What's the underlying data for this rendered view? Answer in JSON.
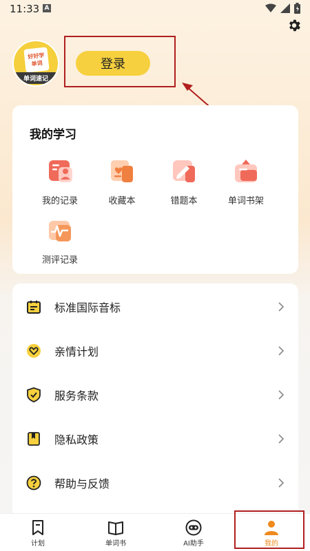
{
  "status_bar": {
    "time": "11:33",
    "notif_letter": "A"
  },
  "header": {
    "avatar_line1": "好好学",
    "avatar_line2": "单词",
    "avatar_ribbon": "单词速记",
    "login_label": "登录"
  },
  "study": {
    "title": "我的学习",
    "items": [
      {
        "label": "我的记录",
        "icon": "record-icon"
      },
      {
        "label": "收藏本",
        "icon": "favorites-icon"
      },
      {
        "label": "错题本",
        "icon": "wrong-answers-icon"
      },
      {
        "label": "单词书架",
        "icon": "bookshelf-icon"
      },
      {
        "label": "测评记录",
        "icon": "assessment-icon"
      }
    ]
  },
  "menu": {
    "items": [
      {
        "label": "标准国际音标",
        "icon": "calendar-icon"
      },
      {
        "label": "亲情计划",
        "icon": "heart-icon"
      },
      {
        "label": "服务条款",
        "icon": "shield-check-icon"
      },
      {
        "label": "隐私政策",
        "icon": "bookmark-book-icon"
      },
      {
        "label": "帮助与反馈",
        "icon": "help-icon"
      }
    ]
  },
  "bottom_nav": {
    "items": [
      {
        "label": "计划",
        "icon": "plan-icon"
      },
      {
        "label": "单词书",
        "icon": "book-icon"
      },
      {
        "label": "AI助手",
        "icon": "ai-assistant-icon"
      },
      {
        "label": "我的",
        "icon": "profile-icon",
        "active": true
      }
    ]
  },
  "colors": {
    "accent": "#f6d03e",
    "active_tab": "#ef8a1e",
    "annotation": "#b01e1e"
  }
}
